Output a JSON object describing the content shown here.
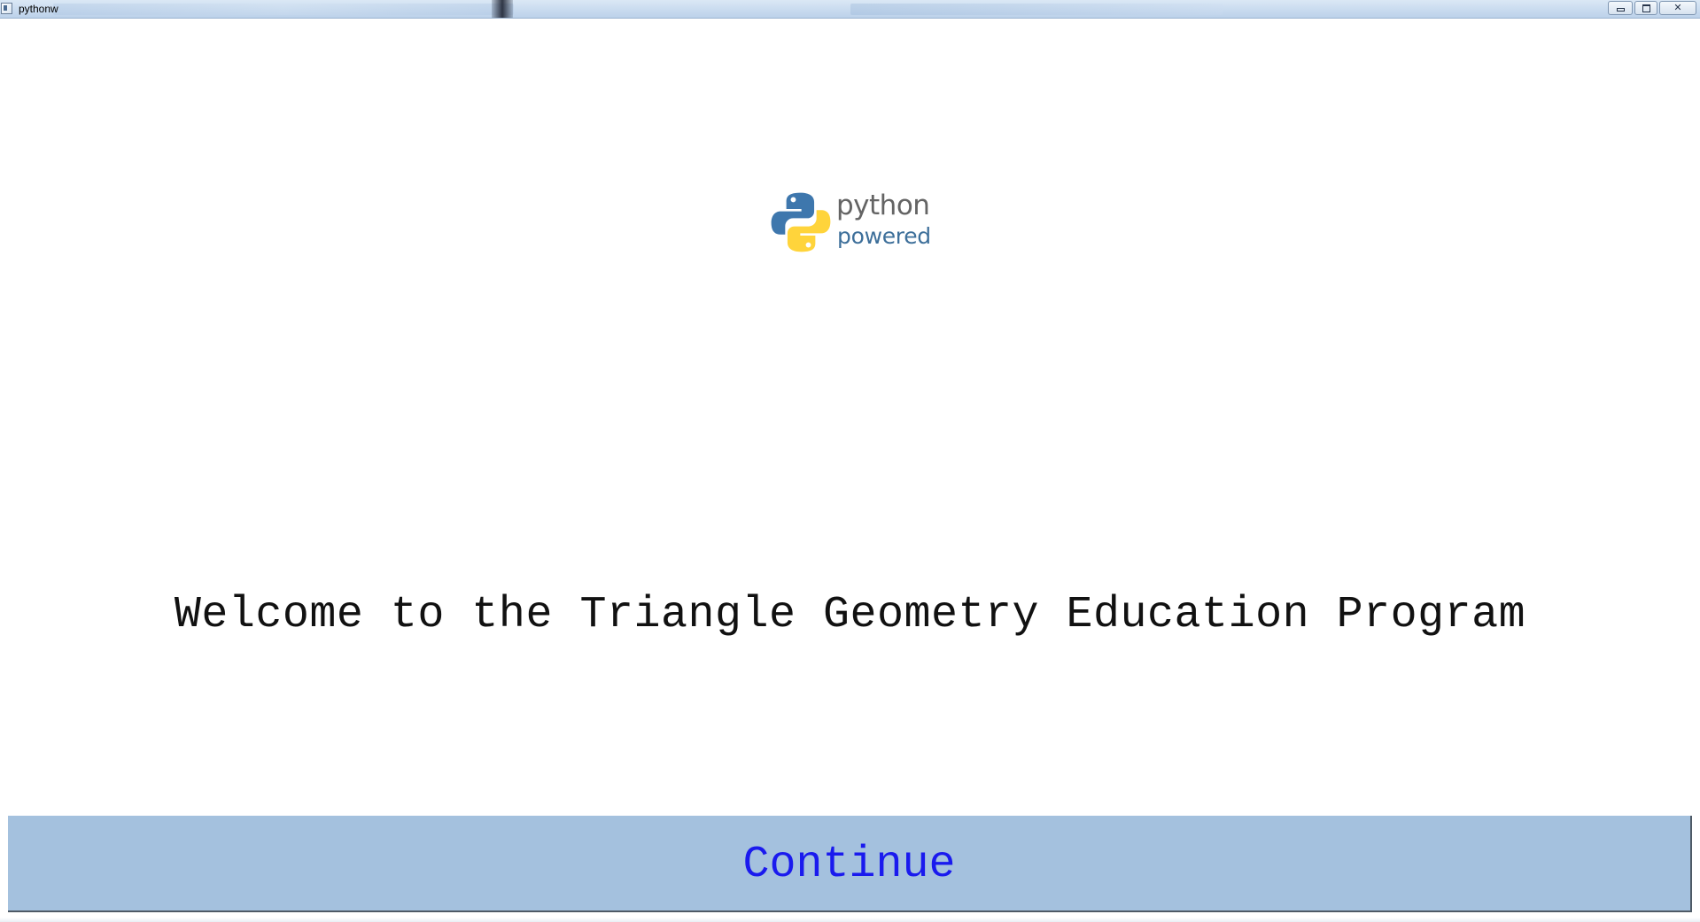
{
  "window": {
    "title": "pythonw",
    "controls": {
      "minimize": "minimize",
      "maximize": "maximize",
      "close": "close"
    }
  },
  "logo": {
    "word1": "python",
    "word2": "powered",
    "colors": {
      "blue": "#3e77ad",
      "yellow": "#ffd43b"
    }
  },
  "main": {
    "welcome_text": "Welcome to the Triangle Geometry Education Program"
  },
  "continue_button": {
    "label": "Continue",
    "background": "#a4c1de",
    "text_color": "#1a1aee"
  }
}
